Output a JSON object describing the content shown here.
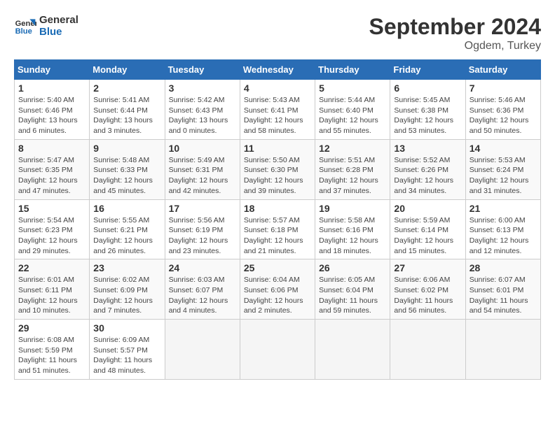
{
  "logo": {
    "line1": "General",
    "line2": "Blue"
  },
  "title": "September 2024",
  "location": "Ogdem, Turkey",
  "days_of_week": [
    "Sunday",
    "Monday",
    "Tuesday",
    "Wednesday",
    "Thursday",
    "Friday",
    "Saturday"
  ],
  "weeks": [
    [
      {
        "day": "1",
        "sunrise": "5:40 AM",
        "sunset": "6:46 PM",
        "daylight": "13 hours and 6 minutes."
      },
      {
        "day": "2",
        "sunrise": "5:41 AM",
        "sunset": "6:44 PM",
        "daylight": "13 hours and 3 minutes."
      },
      {
        "day": "3",
        "sunrise": "5:42 AM",
        "sunset": "6:43 PM",
        "daylight": "13 hours and 0 minutes."
      },
      {
        "day": "4",
        "sunrise": "5:43 AM",
        "sunset": "6:41 PM",
        "daylight": "12 hours and 58 minutes."
      },
      {
        "day": "5",
        "sunrise": "5:44 AM",
        "sunset": "6:40 PM",
        "daylight": "12 hours and 55 minutes."
      },
      {
        "day": "6",
        "sunrise": "5:45 AM",
        "sunset": "6:38 PM",
        "daylight": "12 hours and 53 minutes."
      },
      {
        "day": "7",
        "sunrise": "5:46 AM",
        "sunset": "6:36 PM",
        "daylight": "12 hours and 50 minutes."
      }
    ],
    [
      {
        "day": "8",
        "sunrise": "5:47 AM",
        "sunset": "6:35 PM",
        "daylight": "12 hours and 47 minutes."
      },
      {
        "day": "9",
        "sunrise": "5:48 AM",
        "sunset": "6:33 PM",
        "daylight": "12 hours and 45 minutes."
      },
      {
        "day": "10",
        "sunrise": "5:49 AM",
        "sunset": "6:31 PM",
        "daylight": "12 hours and 42 minutes."
      },
      {
        "day": "11",
        "sunrise": "5:50 AM",
        "sunset": "6:30 PM",
        "daylight": "12 hours and 39 minutes."
      },
      {
        "day": "12",
        "sunrise": "5:51 AM",
        "sunset": "6:28 PM",
        "daylight": "12 hours and 37 minutes."
      },
      {
        "day": "13",
        "sunrise": "5:52 AM",
        "sunset": "6:26 PM",
        "daylight": "12 hours and 34 minutes."
      },
      {
        "day": "14",
        "sunrise": "5:53 AM",
        "sunset": "6:24 PM",
        "daylight": "12 hours and 31 minutes."
      }
    ],
    [
      {
        "day": "15",
        "sunrise": "5:54 AM",
        "sunset": "6:23 PM",
        "daylight": "12 hours and 29 minutes."
      },
      {
        "day": "16",
        "sunrise": "5:55 AM",
        "sunset": "6:21 PM",
        "daylight": "12 hours and 26 minutes."
      },
      {
        "day": "17",
        "sunrise": "5:56 AM",
        "sunset": "6:19 PM",
        "daylight": "12 hours and 23 minutes."
      },
      {
        "day": "18",
        "sunrise": "5:57 AM",
        "sunset": "6:18 PM",
        "daylight": "12 hours and 21 minutes."
      },
      {
        "day": "19",
        "sunrise": "5:58 AM",
        "sunset": "6:16 PM",
        "daylight": "12 hours and 18 minutes."
      },
      {
        "day": "20",
        "sunrise": "5:59 AM",
        "sunset": "6:14 PM",
        "daylight": "12 hours and 15 minutes."
      },
      {
        "day": "21",
        "sunrise": "6:00 AM",
        "sunset": "6:13 PM",
        "daylight": "12 hours and 12 minutes."
      }
    ],
    [
      {
        "day": "22",
        "sunrise": "6:01 AM",
        "sunset": "6:11 PM",
        "daylight": "12 hours and 10 minutes."
      },
      {
        "day": "23",
        "sunrise": "6:02 AM",
        "sunset": "6:09 PM",
        "daylight": "12 hours and 7 minutes."
      },
      {
        "day": "24",
        "sunrise": "6:03 AM",
        "sunset": "6:07 PM",
        "daylight": "12 hours and 4 minutes."
      },
      {
        "day": "25",
        "sunrise": "6:04 AM",
        "sunset": "6:06 PM",
        "daylight": "12 hours and 2 minutes."
      },
      {
        "day": "26",
        "sunrise": "6:05 AM",
        "sunset": "6:04 PM",
        "daylight": "11 hours and 59 minutes."
      },
      {
        "day": "27",
        "sunrise": "6:06 AM",
        "sunset": "6:02 PM",
        "daylight": "11 hours and 56 minutes."
      },
      {
        "day": "28",
        "sunrise": "6:07 AM",
        "sunset": "6:01 PM",
        "daylight": "11 hours and 54 minutes."
      }
    ],
    [
      {
        "day": "29",
        "sunrise": "6:08 AM",
        "sunset": "5:59 PM",
        "daylight": "11 hours and 51 minutes."
      },
      {
        "day": "30",
        "sunrise": "6:09 AM",
        "sunset": "5:57 PM",
        "daylight": "11 hours and 48 minutes."
      },
      null,
      null,
      null,
      null,
      null
    ]
  ]
}
